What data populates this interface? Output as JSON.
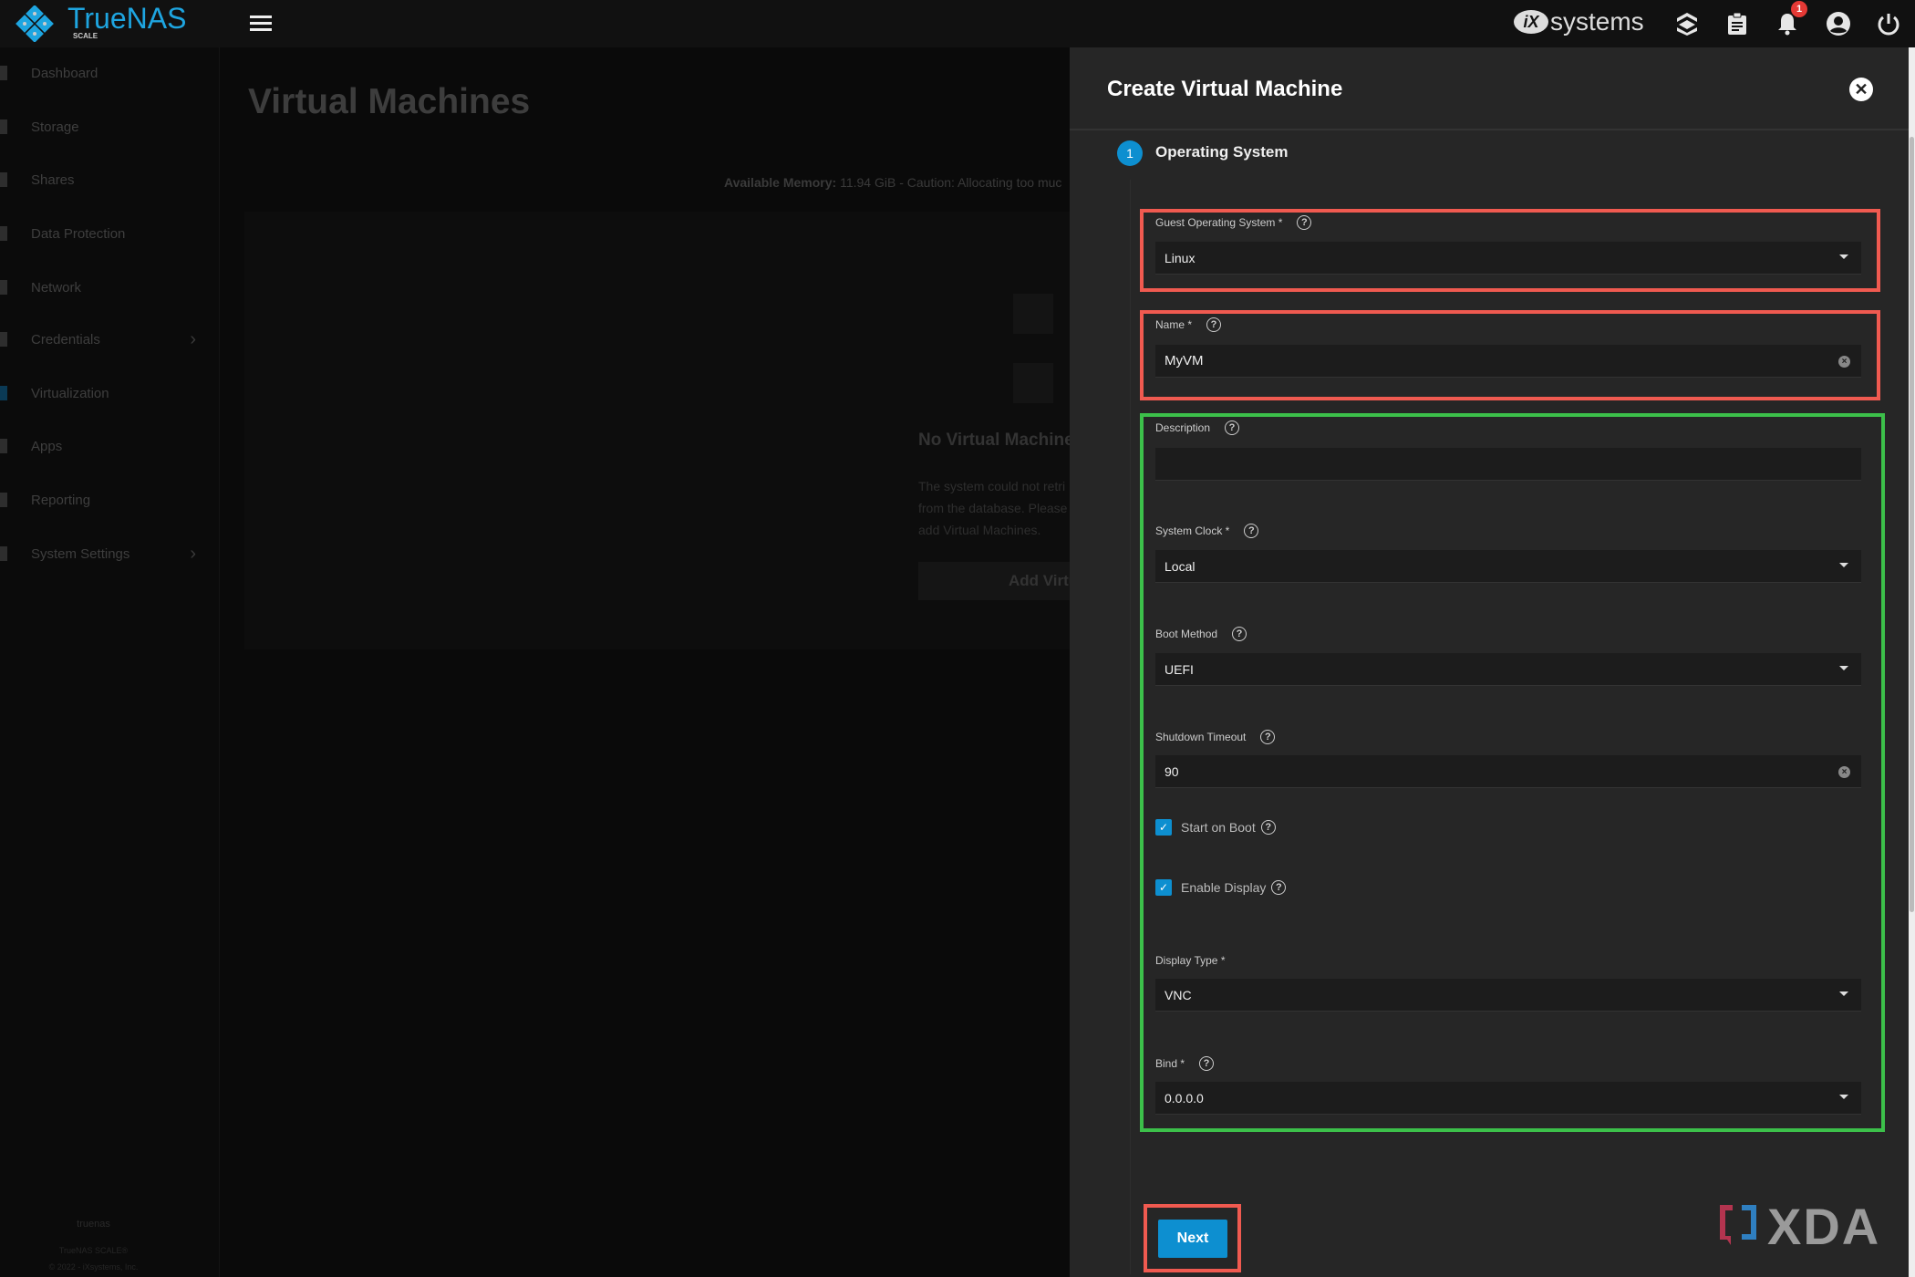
{
  "topbar": {
    "brand": "TrueNAS",
    "brand_sub": "SCALE",
    "vendor_logo": "iXsystems",
    "notification_count": "1",
    "icons": [
      "menu-icon",
      "truecommand-icon",
      "clipboard-icon",
      "bell-icon",
      "account-icon",
      "power-icon"
    ]
  },
  "sidebar": {
    "items": [
      {
        "label": "Dashboard"
      },
      {
        "label": "Storage"
      },
      {
        "label": "Shares"
      },
      {
        "label": "Data Protection"
      },
      {
        "label": "Network"
      },
      {
        "label": "Credentials",
        "chevron": true
      },
      {
        "label": "Virtualization"
      },
      {
        "label": "Apps"
      },
      {
        "label": "Reporting"
      },
      {
        "label": "System Settings",
        "chevron": true
      }
    ],
    "footer": {
      "hostname": "truenas",
      "product": "TrueNAS SCALE®",
      "copyright": "© 2022 - iXsystems, Inc."
    }
  },
  "main": {
    "title": "Virtual Machines",
    "memory_label": "Available Memory:",
    "memory_text": "11.94 GiB - Caution: Allocating too muc",
    "empty_title": "No Virtual Machines",
    "empty_lines": [
      "The system could not retri",
      "from the database. Please",
      "add Virtual Machines."
    ],
    "add_button": "Add Virtu"
  },
  "panel": {
    "title": "Create Virtual Machine",
    "step_number": "1",
    "step_label": "Operating System",
    "fields": {
      "guest_os": {
        "label": "Guest Operating System *",
        "value": "Linux"
      },
      "name": {
        "label": "Name *",
        "value": "MyVM"
      },
      "description": {
        "label": "Description",
        "value": ""
      },
      "system_clock": {
        "label": "System Clock *",
        "value": "Local"
      },
      "boot_method": {
        "label": "Boot Method",
        "value": "UEFI"
      },
      "shutdown_timeout": {
        "label": "Shutdown Timeout",
        "value": "90"
      },
      "start_on_boot": {
        "label": "Start on Boot",
        "checked": true
      },
      "enable_display": {
        "label": "Enable Display",
        "checked": true
      },
      "display_type": {
        "label": "Display Type *",
        "value": "VNC"
      },
      "bind": {
        "label": "Bind *",
        "value": "0.0.0.0"
      }
    },
    "next_button": "Next"
  },
  "annotations": {
    "red": "#f05a50",
    "green": "#3cc04a"
  },
  "colors": {
    "accent": "#0d8fd0",
    "brand": "#1ea5e0"
  },
  "watermark": "XDA"
}
